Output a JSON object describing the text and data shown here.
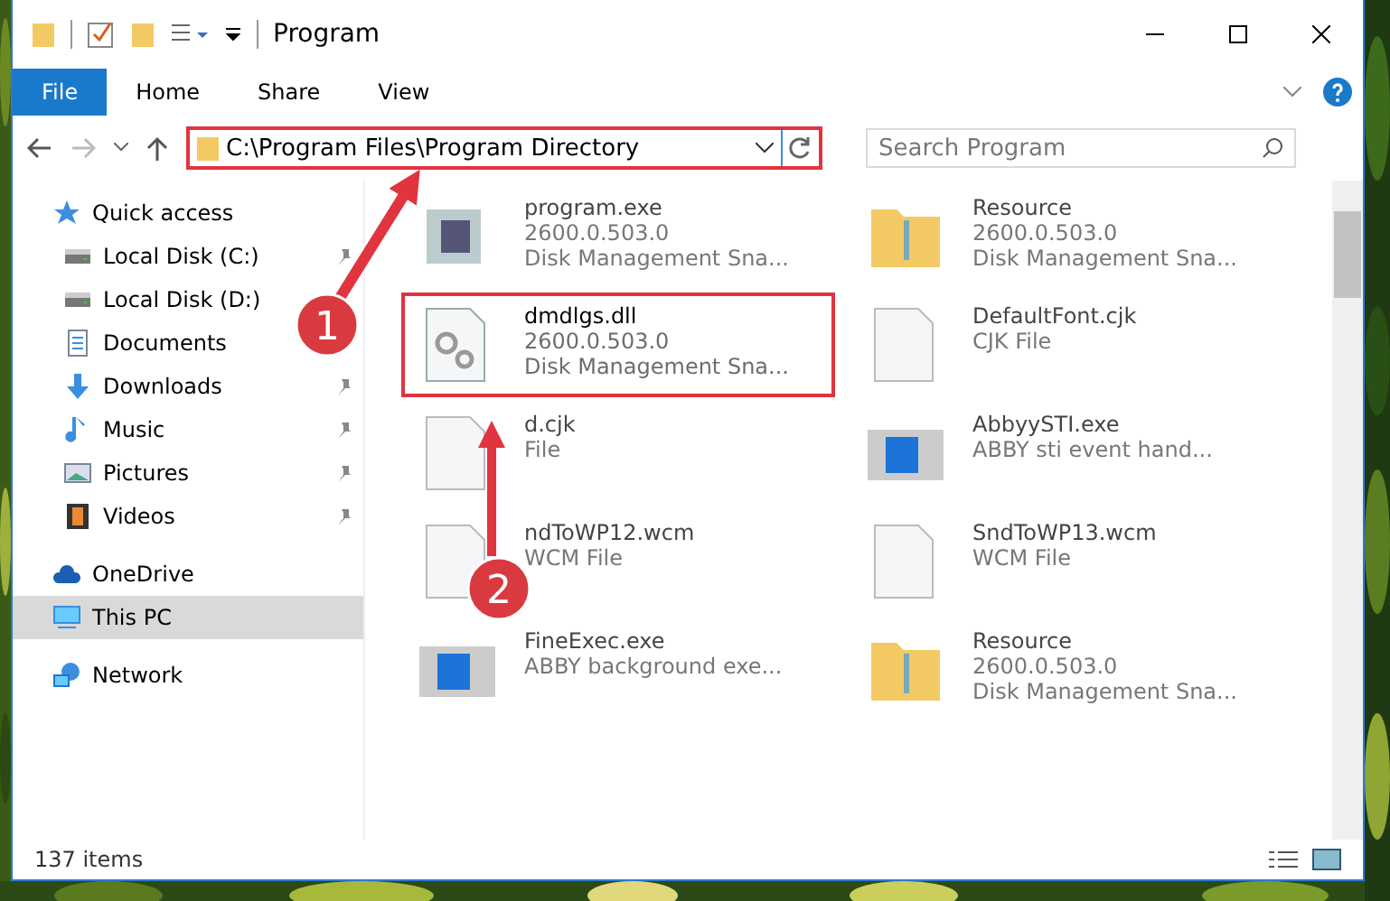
{
  "window": {
    "title": "Program"
  },
  "ribbon_tabs": [
    {
      "label": "File",
      "selected": true
    },
    {
      "label": "Home",
      "selected": false
    },
    {
      "label": "Share",
      "selected": false
    },
    {
      "label": "View",
      "selected": false
    }
  ],
  "address_bar": {
    "path": "C:\\Program Files\\Program Directory"
  },
  "search": {
    "placeholder": "Search Program"
  },
  "sidebar": {
    "items": [
      {
        "label": "Quick access",
        "kind": "star",
        "pinned": false,
        "selected": false,
        "children": [
          {
            "label": "Local Disk (C:)",
            "kind": "disk",
            "pinned": true,
            "selected": false
          },
          {
            "label": "Local Disk (D:)",
            "kind": "disk",
            "pinned": false,
            "selected": false
          },
          {
            "label": "Documents",
            "kind": "document",
            "pinned": false,
            "selected": false
          },
          {
            "label": "Downloads",
            "kind": "download",
            "pinned": true,
            "selected": false
          },
          {
            "label": "Music",
            "kind": "music",
            "pinned": true,
            "selected": false
          },
          {
            "label": "Pictures",
            "kind": "pictures",
            "pinned": true,
            "selected": false
          },
          {
            "label": "Videos",
            "kind": "videos",
            "pinned": true,
            "selected": false
          }
        ]
      },
      {
        "label": "OneDrive",
        "kind": "cloud",
        "pinned": false,
        "selected": false
      },
      {
        "label": "This PC",
        "kind": "pc",
        "pinned": false,
        "selected": true
      },
      {
        "label": "Network",
        "kind": "network",
        "pinned": false,
        "selected": false
      }
    ]
  },
  "files": [
    {
      "name": "program.exe",
      "lines": [
        "2600.0.503.0",
        "Disk Management Sna..."
      ],
      "kind": "program",
      "highlighted": false
    },
    {
      "name": "Resource",
      "lines": [
        "2600.0.503.0",
        "Disk Management Sna..."
      ],
      "kind": "folder",
      "highlighted": false
    },
    {
      "name": "dmdlgs.dll",
      "lines": [
        "2600.0.503.0",
        "Disk Management Sna..."
      ],
      "kind": "dll",
      "highlighted": true
    },
    {
      "name": "DefaultFont.cjk",
      "lines": [
        "CJK File"
      ],
      "kind": "blank",
      "highlighted": false
    },
    {
      "name": "d.cjk",
      "lines": [
        "File"
      ],
      "kind": "blank",
      "highlighted": false
    },
    {
      "name": "AbbyySTI.exe",
      "lines": [
        "ABBY sti event hand..."
      ],
      "kind": "app",
      "highlighted": false
    },
    {
      "name": "ndToWP12.wcm",
      "lines": [
        "WCM File"
      ],
      "kind": "blank",
      "highlighted": false
    },
    {
      "name": "SndToWP13.wcm",
      "lines": [
        "WCM File"
      ],
      "kind": "blank",
      "highlighted": false
    },
    {
      "name": "FineExec.exe",
      "lines": [
        "ABBY background exe..."
      ],
      "kind": "app",
      "highlighted": false
    },
    {
      "name": "Resource",
      "lines": [
        "2600.0.503.0",
        "Disk Management Sna..."
      ],
      "kind": "folder",
      "highlighted": false
    }
  ],
  "annotations": [
    {
      "number": "1"
    },
    {
      "number": "2"
    }
  ],
  "status_bar": {
    "count": "137 items"
  }
}
